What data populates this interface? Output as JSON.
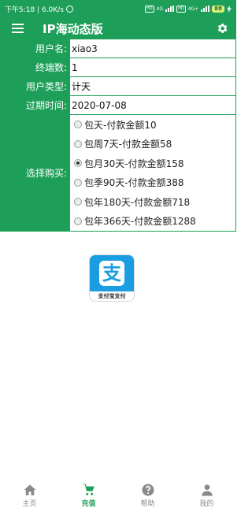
{
  "status_bar": {
    "time_speed": "下午5:18 | 6.0K/s",
    "network_1": "4G",
    "network_2": "4G+",
    "battery": "88"
  },
  "app_bar": {
    "menu_icon": "hamburger-menu-icon",
    "title": "IP海动态版",
    "settings_icon": "gear-icon"
  },
  "form": {
    "username": {
      "label": "用户名:",
      "value": "xiao3"
    },
    "terminals": {
      "label": "终端数:",
      "value": "1"
    },
    "user_type": {
      "label": "用户类型:",
      "value": "计天"
    },
    "expiry": {
      "label": "过期时间:",
      "value": "2020-07-08"
    },
    "purchase": {
      "label": "选择购买:",
      "options": [
        {
          "label": "包天-付款金额10",
          "selected": false
        },
        {
          "label": "包周7天-付款金额58",
          "selected": false
        },
        {
          "label": "包月30天-付款金额158",
          "selected": true
        },
        {
          "label": "包季90天-付款金额388",
          "selected": false
        },
        {
          "label": "包年180天-付款金额718",
          "selected": false
        },
        {
          "label": "包年366天-付款金额1288",
          "selected": false
        }
      ]
    }
  },
  "alipay": {
    "glyph": "支",
    "caption": "支付宝支付",
    "icon": "alipay-icon"
  },
  "tabs": [
    {
      "label": "主页",
      "icon": "home-icon",
      "active": false
    },
    {
      "label": "充值",
      "icon": "cart-icon",
      "active": true
    },
    {
      "label": "帮助",
      "icon": "help-icon",
      "active": false
    },
    {
      "label": "我的",
      "icon": "person-icon",
      "active": false
    }
  ],
  "colors": {
    "primary": "#1e9f59",
    "alipay_blue": "#1a9de1",
    "inactive": "#8a8a8a"
  }
}
